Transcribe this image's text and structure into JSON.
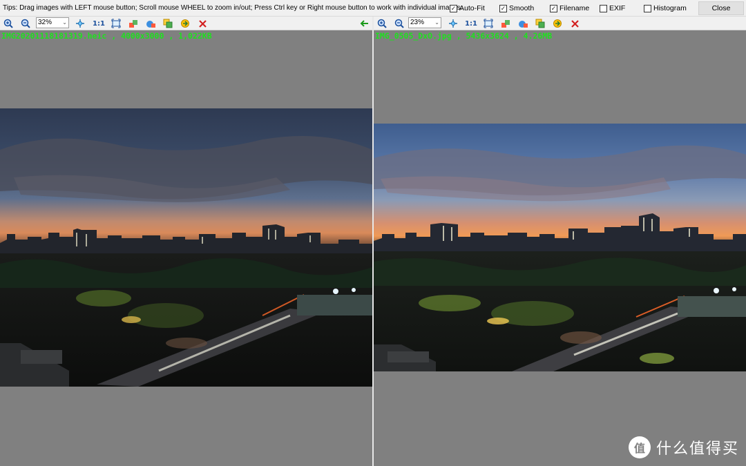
{
  "tips": "Tips: Drag images with LEFT mouse button; Scroll mouse WHEEL to zoom in/out; Press Ctrl key or Right mouse button to work with individual images.",
  "options": [
    {
      "label": "Auto-Fit",
      "checked": true
    },
    {
      "label": "Smooth",
      "checked": true
    },
    {
      "label": "Filename",
      "checked": true
    },
    {
      "label": "EXIF",
      "checked": false
    },
    {
      "label": "Histogram",
      "checked": false
    }
  ],
  "close_label": "Close",
  "left": {
    "zoom": "32%",
    "actual_size_label": "1:1",
    "file_info": "IMG20201118181319.heic , 4000x3000 , 1,022KB"
  },
  "right": {
    "zoom": "23%",
    "actual_size_label": "1:1",
    "file_info": "IMG_0505_DxO.jpg , 5436x3624 , 4.26MB"
  },
  "watermark": {
    "logo": "值",
    "text": "什么值得买"
  },
  "colors": {
    "filename_green": "#1fe01f",
    "pane_bg": "#808080",
    "close_red": "#d32020",
    "arrow_green": "#1a9a1a"
  }
}
